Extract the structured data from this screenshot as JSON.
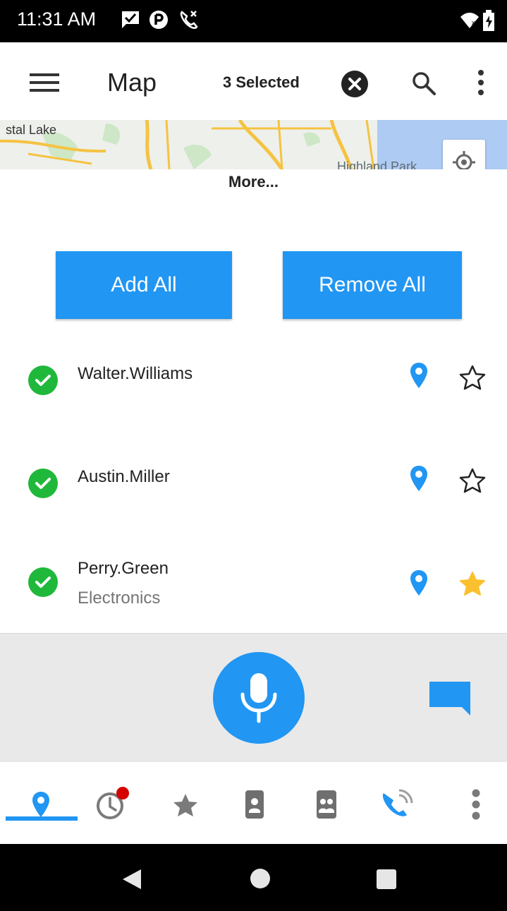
{
  "status_bar": {
    "time": "11:31 AM",
    "icons": [
      "message-check-icon",
      "app-p-icon",
      "missed-call-icon",
      "wifi-icon",
      "battery-charging-icon"
    ]
  },
  "toolbar": {
    "menu_icon": "hamburger-menu-icon",
    "title": "Map",
    "selected_text": "3 Selected",
    "clear_icon": "close-circle-icon",
    "search_icon": "search-icon",
    "overflow_icon": "more-vert-icon"
  },
  "map": {
    "label_left": "stal Lake",
    "label_right": "Highland Park"
  },
  "more_label": "More...",
  "buttons": {
    "add_all": "Add All",
    "remove_all": "Remove All"
  },
  "contacts": [
    {
      "name": "Walter.Williams",
      "subtitle": "",
      "selected": true,
      "favorite": false
    },
    {
      "name": "Austin.Miller",
      "subtitle": "",
      "selected": true,
      "favorite": false
    },
    {
      "name": "Perry.Green",
      "subtitle": "Electronics",
      "selected": true,
      "favorite": true
    }
  ],
  "tabs": [
    "map-pin-icon",
    "history-icon",
    "favorites-star-icon",
    "contacts-icon",
    "groups-icon",
    "calls-icon",
    "more-vert-icon"
  ],
  "colors": {
    "accent": "#2196f3",
    "check": "#1fb83b",
    "star_filled": "#fbc02d",
    "badge": "#d50000"
  }
}
